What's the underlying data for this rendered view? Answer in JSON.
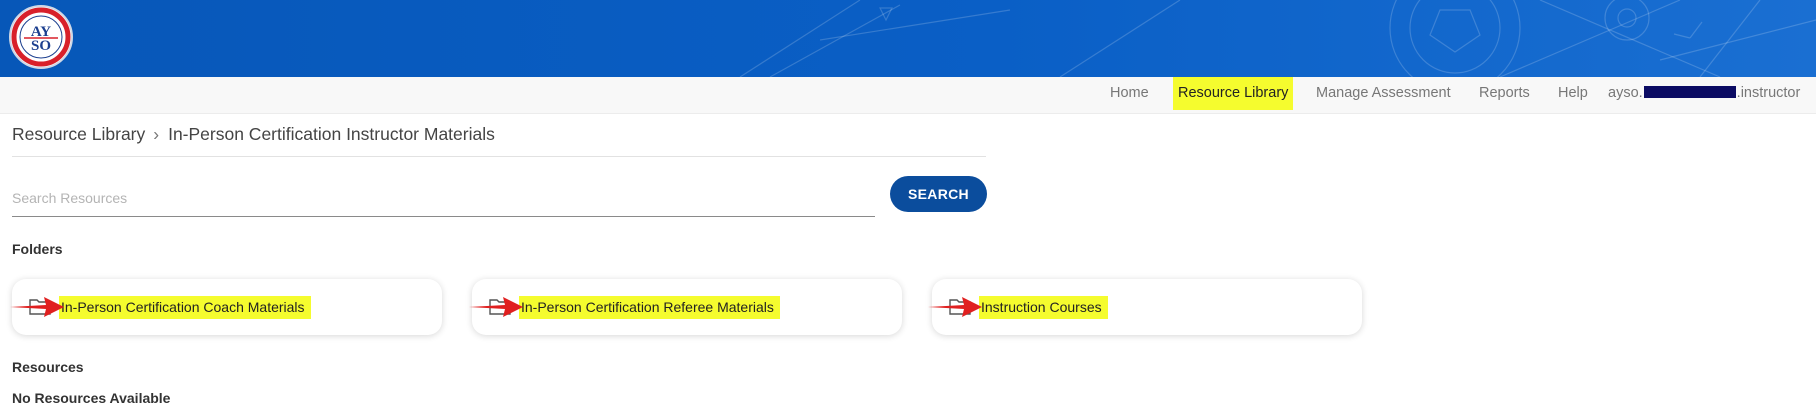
{
  "logo": {
    "alt": "AYSO",
    "ring_text": "AMERICAN YOUTH SOCCER ORGANIZATION · FOUNDED 1964"
  },
  "nav": {
    "items": [
      {
        "label": "Home",
        "active": false
      },
      {
        "label": "Resource Library",
        "active": true
      },
      {
        "label": "Manage Assessment",
        "active": false
      },
      {
        "label": "Reports",
        "active": false
      },
      {
        "label": "Help",
        "active": false
      }
    ],
    "user_prefix": "ayso.",
    "user_suffix": ".instructor"
  },
  "breadcrumb": {
    "parent": "Resource Library",
    "current": "In-Person Certification Instructor Materials"
  },
  "search": {
    "placeholder": "Search Resources",
    "value": "",
    "button_label": "SEARCH"
  },
  "folders": {
    "heading": "Folders",
    "items": [
      {
        "label": "In-Person Certification Coach Materials"
      },
      {
        "label": "In-Person Certification Referee Materials"
      },
      {
        "label": "Instruction Courses"
      }
    ]
  },
  "resources": {
    "heading": "Resources",
    "empty_text": "No Resources Available"
  },
  "colors": {
    "banner": "#0757b8",
    "highlight": "#f5fc2e",
    "button": "#0b4d9d",
    "annotation_arrow": "#e02020"
  }
}
